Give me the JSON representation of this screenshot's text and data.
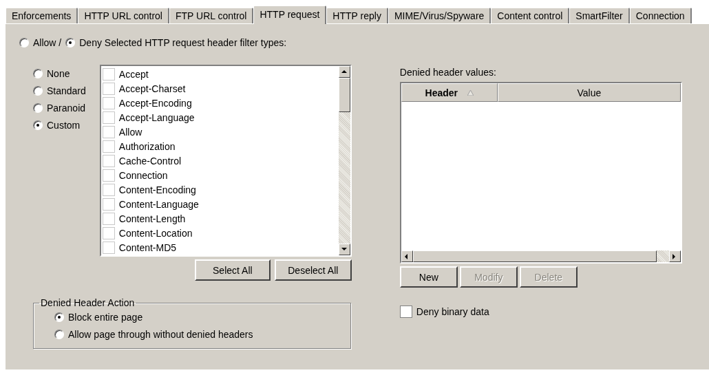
{
  "tabs": [
    {
      "label": "Enforcements",
      "selected": false
    },
    {
      "label": "HTTP URL control",
      "selected": false
    },
    {
      "label": "FTP URL control",
      "selected": false
    },
    {
      "label": "HTTP request",
      "selected": true
    },
    {
      "label": "HTTP reply",
      "selected": false
    },
    {
      "label": "MIME/Virus/Spyware",
      "selected": false
    },
    {
      "label": "Content control",
      "selected": false
    },
    {
      "label": "SmartFilter",
      "selected": false
    },
    {
      "label": "Connection",
      "selected": false
    }
  ],
  "filter_mode": [
    {
      "label": "Allow /",
      "selected": false
    },
    {
      "label": "Deny Selected HTTP request header filter types:",
      "selected": true
    }
  ],
  "presets": [
    {
      "label": "None",
      "selected": false
    },
    {
      "label": "Standard",
      "selected": false
    },
    {
      "label": "Paranoid",
      "selected": false
    },
    {
      "label": "Custom",
      "selected": true
    }
  ],
  "header_types": [
    {
      "label": "Accept",
      "checked": false
    },
    {
      "label": "Accept-Charset",
      "checked": false
    },
    {
      "label": "Accept-Encoding",
      "checked": false
    },
    {
      "label": "Accept-Language",
      "checked": false
    },
    {
      "label": "Allow",
      "checked": false
    },
    {
      "label": "Authorization",
      "checked": false
    },
    {
      "label": "Cache-Control",
      "checked": false
    },
    {
      "label": "Connection",
      "checked": false
    },
    {
      "label": "Content-Encoding",
      "checked": false
    },
    {
      "label": "Content-Language",
      "checked": false
    },
    {
      "label": "Content-Length",
      "checked": false
    },
    {
      "label": "Content-Location",
      "checked": false
    },
    {
      "label": "Content-MD5",
      "checked": false
    }
  ],
  "list_buttons": [
    {
      "label": "Select All",
      "disabled": false
    },
    {
      "label": "Deselect All",
      "disabled": false
    }
  ],
  "denied_values": {
    "label": "Denied header values:",
    "columns": [
      {
        "label": "Header",
        "sorted": true
      },
      {
        "label": "Value",
        "sorted": false
      }
    ]
  },
  "table_buttons": [
    {
      "label": "New",
      "disabled": false
    },
    {
      "label": "Modify",
      "disabled": true
    },
    {
      "label": "Delete",
      "disabled": true
    }
  ],
  "deny_binary": {
    "label": "Deny binary data",
    "checked": false
  },
  "action_group": {
    "title": "Denied Header Action",
    "options": [
      {
        "label": "Block entire page",
        "selected": true
      },
      {
        "label": "Allow page through without denied headers",
        "selected": false
      }
    ]
  }
}
